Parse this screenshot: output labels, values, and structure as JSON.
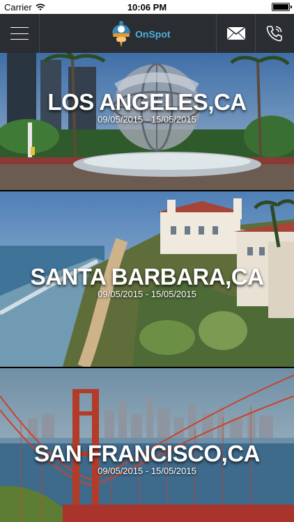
{
  "status_bar": {
    "carrier": "Carrier",
    "time": "10:06 PM",
    "wifi_icon": "wifi-icon",
    "battery_icon": "battery-icon"
  },
  "navbar": {
    "brand": "OnSpot",
    "menu_icon": "hamburger-menu-icon",
    "mail_icon": "mail-icon",
    "phone_icon": "phone-icon",
    "background": "#2a2d31",
    "brand_color": "#4fb0df"
  },
  "cities": [
    {
      "name": "LOS ANGELES,CA",
      "dates": "09/05/2015 - 15/05/2015"
    },
    {
      "name": "SANTA BARBARA,CA",
      "dates": "09/05/2015 - 15/05/2015"
    },
    {
      "name": "SAN FRANCISCO,CA",
      "dates": "09/05/2015 - 15/05/2015"
    }
  ]
}
